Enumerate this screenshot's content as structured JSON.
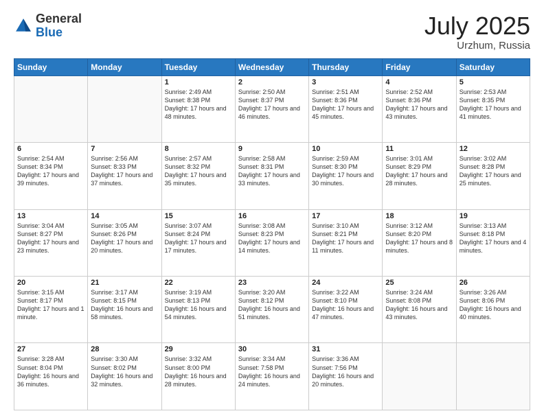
{
  "header": {
    "logo_general": "General",
    "logo_blue": "Blue",
    "month": "July 2025",
    "location": "Urzhum, Russia"
  },
  "days_of_week": [
    "Sunday",
    "Monday",
    "Tuesday",
    "Wednesday",
    "Thursday",
    "Friday",
    "Saturday"
  ],
  "weeks": [
    [
      {
        "day": "",
        "info": ""
      },
      {
        "day": "",
        "info": ""
      },
      {
        "day": "1",
        "info": "Sunrise: 2:49 AM\nSunset: 8:38 PM\nDaylight: 17 hours and 48 minutes."
      },
      {
        "day": "2",
        "info": "Sunrise: 2:50 AM\nSunset: 8:37 PM\nDaylight: 17 hours and 46 minutes."
      },
      {
        "day": "3",
        "info": "Sunrise: 2:51 AM\nSunset: 8:36 PM\nDaylight: 17 hours and 45 minutes."
      },
      {
        "day": "4",
        "info": "Sunrise: 2:52 AM\nSunset: 8:36 PM\nDaylight: 17 hours and 43 minutes."
      },
      {
        "day": "5",
        "info": "Sunrise: 2:53 AM\nSunset: 8:35 PM\nDaylight: 17 hours and 41 minutes."
      }
    ],
    [
      {
        "day": "6",
        "info": "Sunrise: 2:54 AM\nSunset: 8:34 PM\nDaylight: 17 hours and 39 minutes."
      },
      {
        "day": "7",
        "info": "Sunrise: 2:56 AM\nSunset: 8:33 PM\nDaylight: 17 hours and 37 minutes."
      },
      {
        "day": "8",
        "info": "Sunrise: 2:57 AM\nSunset: 8:32 PM\nDaylight: 17 hours and 35 minutes."
      },
      {
        "day": "9",
        "info": "Sunrise: 2:58 AM\nSunset: 8:31 PM\nDaylight: 17 hours and 33 minutes."
      },
      {
        "day": "10",
        "info": "Sunrise: 2:59 AM\nSunset: 8:30 PM\nDaylight: 17 hours and 30 minutes."
      },
      {
        "day": "11",
        "info": "Sunrise: 3:01 AM\nSunset: 8:29 PM\nDaylight: 17 hours and 28 minutes."
      },
      {
        "day": "12",
        "info": "Sunrise: 3:02 AM\nSunset: 8:28 PM\nDaylight: 17 hours and 25 minutes."
      }
    ],
    [
      {
        "day": "13",
        "info": "Sunrise: 3:04 AM\nSunset: 8:27 PM\nDaylight: 17 hours and 23 minutes."
      },
      {
        "day": "14",
        "info": "Sunrise: 3:05 AM\nSunset: 8:26 PM\nDaylight: 17 hours and 20 minutes."
      },
      {
        "day": "15",
        "info": "Sunrise: 3:07 AM\nSunset: 8:24 PM\nDaylight: 17 hours and 17 minutes."
      },
      {
        "day": "16",
        "info": "Sunrise: 3:08 AM\nSunset: 8:23 PM\nDaylight: 17 hours and 14 minutes."
      },
      {
        "day": "17",
        "info": "Sunrise: 3:10 AM\nSunset: 8:21 PM\nDaylight: 17 hours and 11 minutes."
      },
      {
        "day": "18",
        "info": "Sunrise: 3:12 AM\nSunset: 8:20 PM\nDaylight: 17 hours and 8 minutes."
      },
      {
        "day": "19",
        "info": "Sunrise: 3:13 AM\nSunset: 8:18 PM\nDaylight: 17 hours and 4 minutes."
      }
    ],
    [
      {
        "day": "20",
        "info": "Sunrise: 3:15 AM\nSunset: 8:17 PM\nDaylight: 17 hours and 1 minute."
      },
      {
        "day": "21",
        "info": "Sunrise: 3:17 AM\nSunset: 8:15 PM\nDaylight: 16 hours and 58 minutes."
      },
      {
        "day": "22",
        "info": "Sunrise: 3:19 AM\nSunset: 8:13 PM\nDaylight: 16 hours and 54 minutes."
      },
      {
        "day": "23",
        "info": "Sunrise: 3:20 AM\nSunset: 8:12 PM\nDaylight: 16 hours and 51 minutes."
      },
      {
        "day": "24",
        "info": "Sunrise: 3:22 AM\nSunset: 8:10 PM\nDaylight: 16 hours and 47 minutes."
      },
      {
        "day": "25",
        "info": "Sunrise: 3:24 AM\nSunset: 8:08 PM\nDaylight: 16 hours and 43 minutes."
      },
      {
        "day": "26",
        "info": "Sunrise: 3:26 AM\nSunset: 8:06 PM\nDaylight: 16 hours and 40 minutes."
      }
    ],
    [
      {
        "day": "27",
        "info": "Sunrise: 3:28 AM\nSunset: 8:04 PM\nDaylight: 16 hours and 36 minutes."
      },
      {
        "day": "28",
        "info": "Sunrise: 3:30 AM\nSunset: 8:02 PM\nDaylight: 16 hours and 32 minutes."
      },
      {
        "day": "29",
        "info": "Sunrise: 3:32 AM\nSunset: 8:00 PM\nDaylight: 16 hours and 28 minutes."
      },
      {
        "day": "30",
        "info": "Sunrise: 3:34 AM\nSunset: 7:58 PM\nDaylight: 16 hours and 24 minutes."
      },
      {
        "day": "31",
        "info": "Sunrise: 3:36 AM\nSunset: 7:56 PM\nDaylight: 16 hours and 20 minutes."
      },
      {
        "day": "",
        "info": ""
      },
      {
        "day": "",
        "info": ""
      }
    ]
  ]
}
